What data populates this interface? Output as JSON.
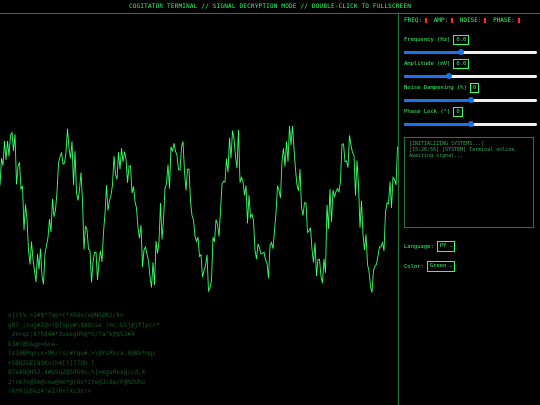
{
  "header": {
    "title": "COGITATOR TERMINAL // SIGNAL DECRYPTION MODE // DOUBLE-CLICK TO FULLSCREEN"
  },
  "status": {
    "freq_label": "FREQ:",
    "amp_label": "AMP:",
    "noise_label": "NOISE:",
    "phase_label": "PHASE:",
    "indicator_color": "#ff2a2a"
  },
  "controls": [
    {
      "label": "Frequency (Hz)",
      "value": "0.0",
      "level": 0.43
    },
    {
      "label": "Amplitude (mV)",
      "value": "0.0",
      "level": 0.34
    },
    {
      "label": "Noise Dampening (%)",
      "value": "0",
      "level": 0.5
    },
    {
      "label": "Phase Lock (°)",
      "value": "0",
      "level": 0.5
    }
  ],
  "log": {
    "lines": [
      "[INITIALIZING SYSTEMS...]",
      "[15:26:56] [SYSTEM] Terminal online.",
      "Awaiting signal..."
    ]
  },
  "language": {
    "label": "Language:",
    "selected": "PY"
  },
  "color": {
    "label": "Color:",
    "selected": "Green"
  },
  "cipher": {
    "lines": [
      "x{(t%:>2#$*?qo+(*X6Ov/x@N&@Kz/k>",
      "g87_;cug#I@>!@[Spy#\\$8Qcse )mc:b5j@jf]pcr*",
      "_2V>qz;8?h$4#*3veegHh@*h/?a^k@$53#4",
      "k3#!@5&gp=&>a-",
      "[s1@BPq/;x>9K/!s/#*qu#:>\\@YsR%/a.8@Bk*mgc",
      "+5BQZ&E[8SKvih4[?{77Ob_[",
      "87eA9@H52.4#DSqZ@S9G9o;%[=mgsRxxq/cd,X",
      "2!rm7n@5m@cnw@4X*@]Ox*zYe@Jc8e/F@N2Uho",
      "!6Y9[p6%z4!eI?0+!Xc3x!>"
    ]
  }
}
